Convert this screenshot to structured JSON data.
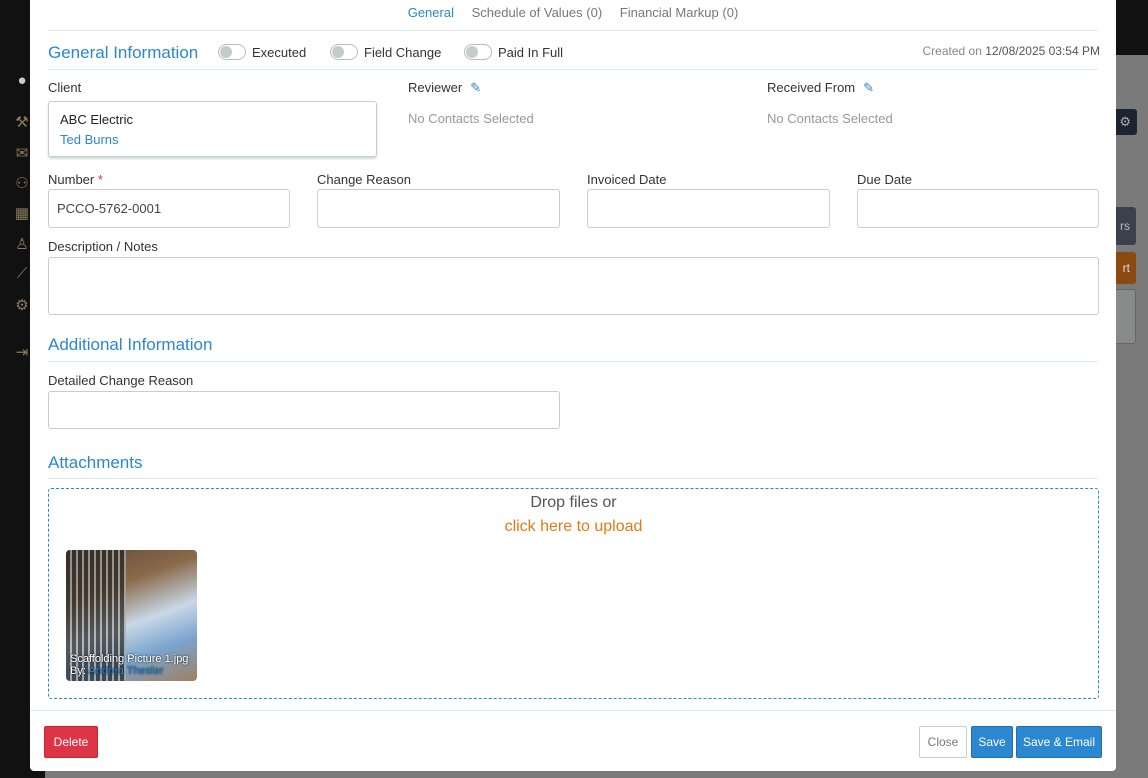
{
  "tabs": [
    {
      "label": "General"
    },
    {
      "label": "Schedule of Values (0)"
    },
    {
      "label": "Financial Markup (0)"
    }
  ],
  "general": {
    "title": "General Information",
    "toggles": [
      {
        "label": "Executed",
        "on": false
      },
      {
        "label": "Field Change",
        "on": false
      },
      {
        "label": "Paid In Full",
        "on": false
      }
    ],
    "created_prefix": "Created on",
    "created": "12/08/2025 03:54 PM"
  },
  "client": {
    "label": "Client",
    "company": "ABC Electric",
    "contact": "Ted Burns"
  },
  "reviewer": {
    "label": "Reviewer",
    "value": "No Contacts Selected"
  },
  "received_from": {
    "label": "Received From",
    "value": "No Contacts Selected"
  },
  "fields": {
    "number_label": "Number",
    "required": "*",
    "number_value": "PCCO-5762-0001",
    "change_reason_label": "Change Reason",
    "invoiced_date_label": "Invoiced Date",
    "due_date_label": "Due Date",
    "description_label": "Description / Notes"
  },
  "additional": {
    "title": "Additional Information",
    "detailed_label": "Detailed Change Reason"
  },
  "attachments": {
    "title": "Attachments",
    "drop_text": "Drop files or",
    "upload_link": "click here to upload",
    "files": [
      {
        "name": "Scaffolding Picture 1.jpg",
        "by": "By:",
        "author": "Andrea Thesler"
      }
    ]
  },
  "buttons": {
    "delete": "Delete",
    "close": "Close",
    "save": "Save",
    "save_email": "Save & Email"
  },
  "background": {
    "btn1": "rs",
    "btn2": "rt"
  }
}
